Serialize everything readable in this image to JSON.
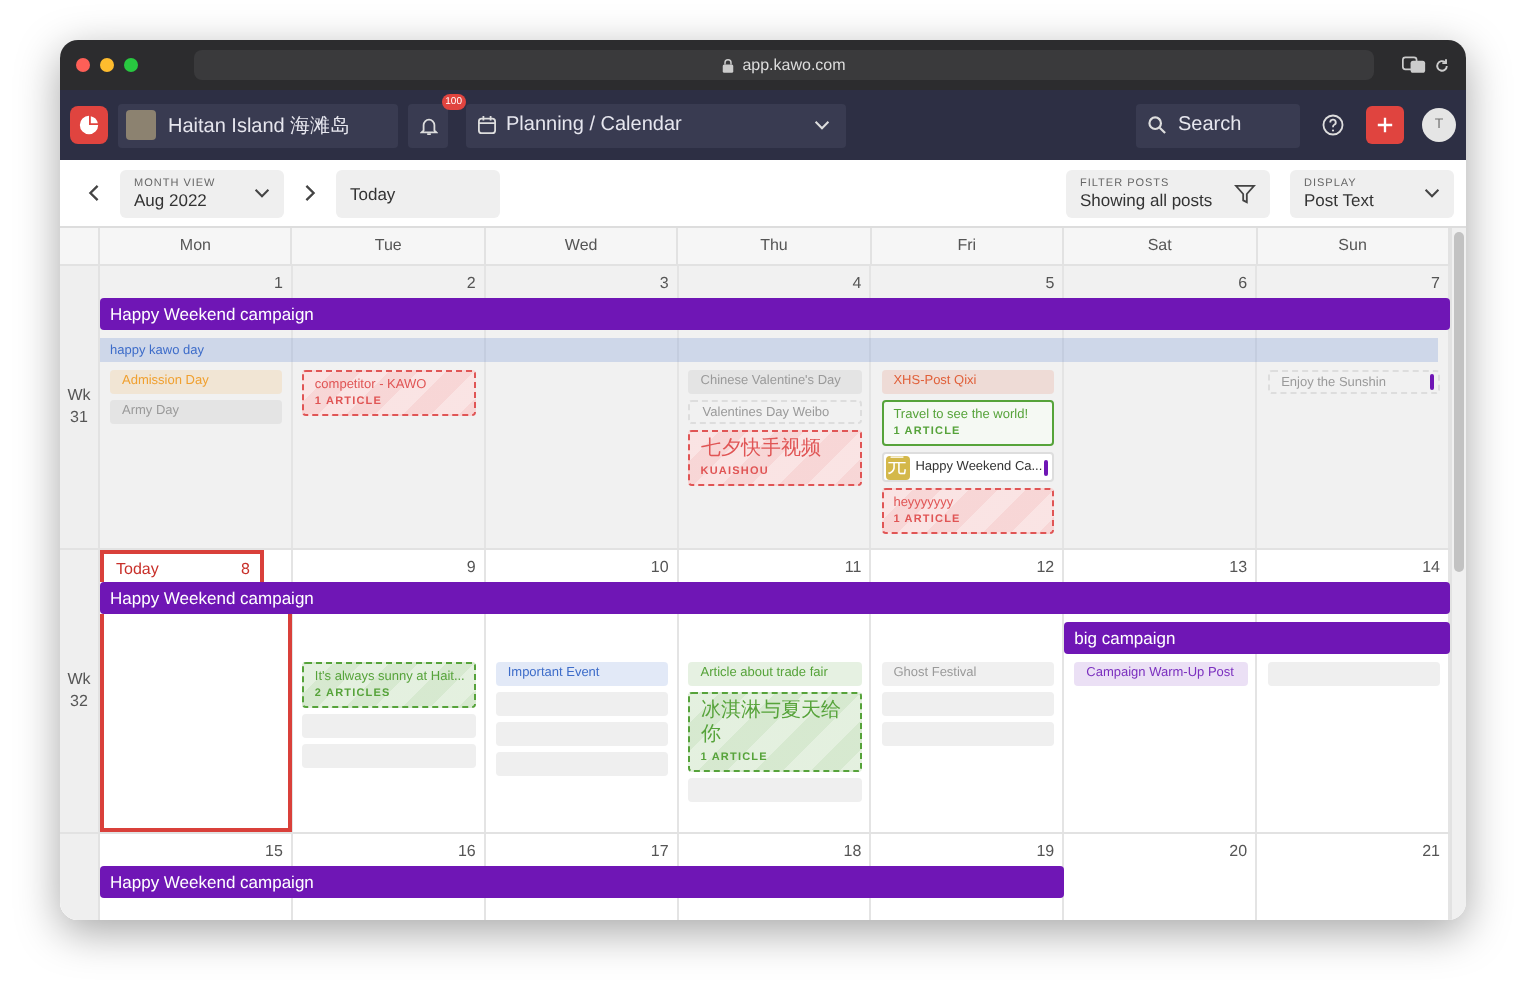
{
  "browser": {
    "url": "app.kawo.com"
  },
  "nav": {
    "workspace": "Haitan Island 海滩岛",
    "notification_count": "100",
    "section": "Planning / Calendar",
    "search": "Search",
    "avatar": "T"
  },
  "toolbar": {
    "view_label": "MONTH VIEW",
    "view_value": "Aug 2022",
    "today": "Today",
    "filter_label": "FILTER POSTS",
    "filter_value": "Showing all posts",
    "display_label": "DISPLAY",
    "display_value": "Post Text"
  },
  "weekdays": [
    "Mon",
    "Tue",
    "Wed",
    "Thu",
    "Fri",
    "Sat",
    "Sun"
  ],
  "weeks": [
    {
      "label": "Wk 31",
      "past": true,
      "bar_rows": [
        {
          "slots": [
            {
              "kind": "campaign",
              "title": "Happy Weekend campaign",
              "color": "#6f16b5"
            },
            {
              "kind": "continued"
            },
            {
              "kind": "continued"
            },
            {
              "kind": "continued"
            },
            {
              "kind": "continued"
            },
            {
              "kind": "continued"
            },
            {
              "kind": "continued"
            }
          ]
        },
        {
          "slots": [
            {
              "kind": "event",
              "title": "happy kawo day",
              "color": "#3d6cc9"
            },
            {
              "kind": "continued"
            },
            {
              "kind": "continued"
            },
            {
              "kind": "continued"
            },
            {
              "kind": "continued"
            },
            {
              "kind": "continued"
            },
            {
              "kind": "continued"
            }
          ]
        }
      ],
      "days": [
        {
          "date": "1",
          "today": false,
          "items": [
            {
              "kind": "label",
              "title": "Admission Day",
              "color": "#f0a030"
            },
            {
              "kind": "label",
              "title": "Army Day",
              "color": "#9a9a9a"
            }
          ]
        },
        {
          "date": "2",
          "today": false,
          "items": [
            {
              "kind": "draft",
              "title": "competitor - KAWO",
              "sub": "1 ARTICLE",
              "color": "#e05555"
            }
          ]
        },
        {
          "date": "3",
          "today": false
        },
        {
          "date": "4",
          "today": false,
          "items": [
            {
              "kind": "label",
              "title": "Chinese Valentine's Day",
              "color": "#9a9a9a"
            },
            {
              "kind": "outline",
              "title": "Valentines Day Weibo",
              "color": "#9a9a9a"
            },
            {
              "kind": "draft",
              "title": "七夕快手视频",
              "sub": "KUAISHOU",
              "color": "#e05555"
            }
          ]
        },
        {
          "date": "5",
          "today": false,
          "items": [
            {
              "kind": "label",
              "title": "XHS-Post Qixi",
              "color": "#e0603a"
            },
            {
              "kind": "card",
              "title": "Travel to see the world!",
              "sub": "1 ARTICLE",
              "color": "#56a33a"
            },
            {
              "kind": "campaign_post",
              "title": "Happy Weekend Ca...",
              "icon_text": "元",
              "marker": {
                "color": "#6f16b5"
              }
            },
            {
              "kind": "draft",
              "title": "heyyyyyyy",
              "sub": "1 ARTICLE",
              "color": "#e05555"
            }
          ]
        },
        {
          "date": "6",
          "today": false
        },
        {
          "date": "7",
          "today": false,
          "items": [
            {
              "kind": "outline",
              "title": "Enjoy the Sunshin",
              "color": "#9a9a9a",
              "marker": {
                "color": "#6f16b5"
              }
            }
          ]
        }
      ]
    },
    {
      "label": "Wk 32",
      "past": false,
      "bar_rows": [
        {
          "slots": [
            {
              "kind": "campaign",
              "title": "Happy Weekend campaign",
              "color": "#6f16b5"
            },
            {
              "kind": "continued"
            },
            {
              "kind": "continued"
            },
            {
              "kind": "continued"
            },
            {
              "kind": "continued"
            },
            {
              "kind": "continued"
            },
            {
              "kind": "continued"
            }
          ]
        },
        {
          "slots": [
            {
              "kind": "empty"
            },
            {
              "kind": "empty"
            },
            {
              "kind": "empty"
            },
            {
              "kind": "empty"
            },
            {
              "kind": "empty"
            },
            {
              "kind": "campaign",
              "title": "big campaign",
              "color": "#6f16b5"
            },
            {
              "kind": "continued"
            }
          ]
        }
      ],
      "days": [
        {
          "date": "8",
          "today": true,
          "today_label": "Today"
        },
        {
          "date": "9",
          "today": false,
          "items": [
            {
              "kind": "draft",
              "title": "It's always sunny at Hait...",
              "sub": "2 ARTICLES",
              "color": "#56a33a"
            },
            {
              "kind": "placeholder"
            },
            {
              "kind": "placeholder"
            }
          ]
        },
        {
          "date": "10",
          "today": false,
          "items": [
            {
              "kind": "label",
              "title": "Important Event",
              "color": "#3d6cc9"
            },
            {
              "kind": "placeholder"
            },
            {
              "kind": "placeholder"
            },
            {
              "kind": "placeholder"
            }
          ]
        },
        {
          "date": "11",
          "today": false,
          "items": [
            {
              "kind": "label",
              "title": "Article about trade fair",
              "color": "#56a33a"
            },
            {
              "kind": "draft",
              "title": "冰淇淋与夏天给你",
              "sub": "1 ARTICLE",
              "color": "#56a33a"
            },
            {
              "kind": "placeholder"
            }
          ]
        },
        {
          "date": "12",
          "today": false,
          "items": [
            {
              "kind": "label",
              "title": "Ghost Festival",
              "color": "#9a9a9a"
            },
            {
              "kind": "placeholder"
            },
            {
              "kind": "placeholder"
            }
          ]
        },
        {
          "date": "13",
          "today": false,
          "items": [
            {
              "kind": "label",
              "title": "Campaign Warm-Up Post",
              "color": "#7b2fbf"
            }
          ]
        },
        {
          "date": "14",
          "today": false,
          "items": [
            {
              "kind": "placeholder"
            }
          ]
        }
      ]
    },
    {
      "past": false,
      "bar_rows": [
        {
          "slots": [
            {
              "kind": "campaign",
              "title": "Happy Weekend campaign",
              "color": "#6f16b5"
            },
            {
              "kind": "continued"
            },
            {
              "kind": "continued"
            },
            {
              "kind": "continued"
            },
            {
              "kind": "continued"
            },
            {
              "kind": "empty"
            },
            {
              "kind": "empty"
            }
          ]
        }
      ],
      "days": [
        {
          "date": "15",
          "today": false
        },
        {
          "date": "16",
          "today": false
        },
        {
          "date": "17",
          "today": false
        },
        {
          "date": "18",
          "today": false
        },
        {
          "date": "19",
          "today": false
        },
        {
          "date": "20",
          "today": false
        },
        {
          "date": "21",
          "today": false
        }
      ]
    }
  ]
}
